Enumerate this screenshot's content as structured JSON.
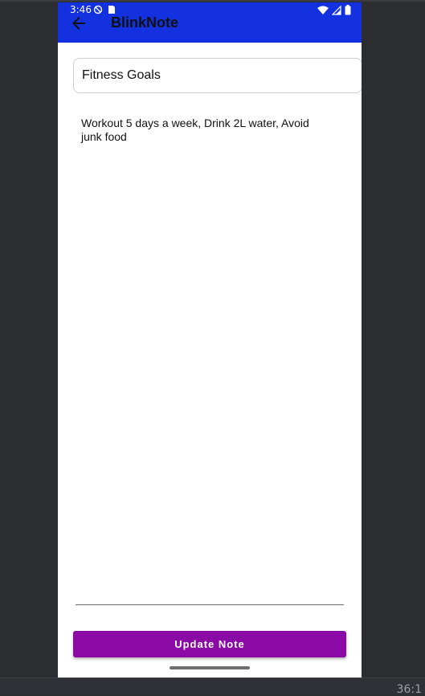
{
  "status_bar": {
    "time": "3:46"
  },
  "app_bar": {
    "title": "BlinkNote",
    "color": "#1431e0"
  },
  "note": {
    "title_value": "Fitness Goals",
    "content": "Workout 5 days a week, Drink 2L water, Avoid junk food"
  },
  "actions": {
    "update_label": "Update Note",
    "button_color": "#8b0aa5"
  },
  "emulator": {
    "coords_text": "36:1"
  }
}
